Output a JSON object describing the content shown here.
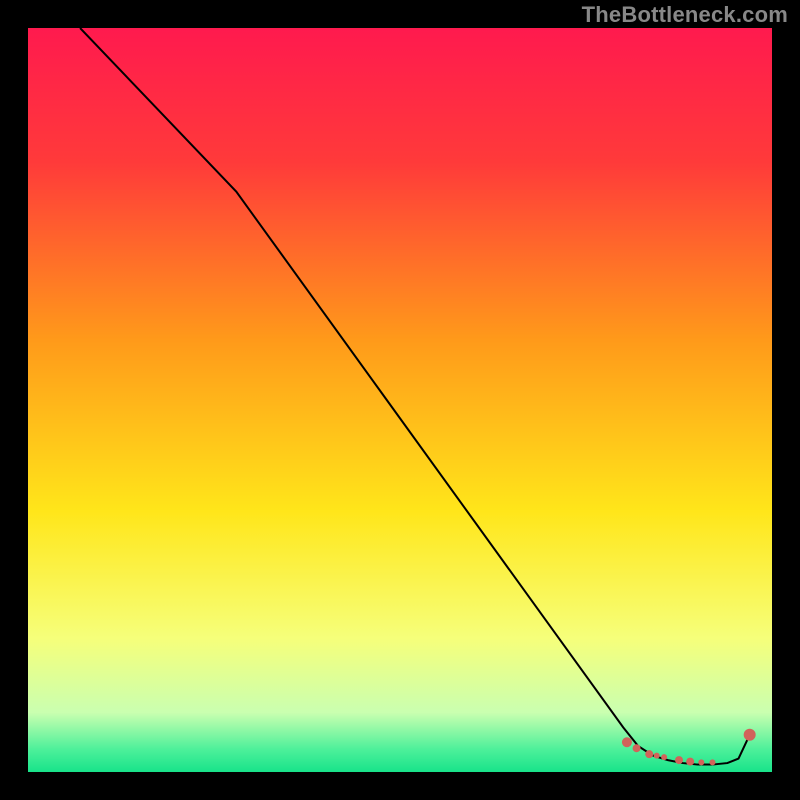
{
  "watermark": "TheBottleneck.com",
  "chart_data": {
    "type": "line",
    "title": "",
    "xlabel": "",
    "ylabel": "",
    "xlim": [
      0,
      100
    ],
    "ylim": [
      0,
      100
    ],
    "grid": false,
    "legend": null,
    "gradient": [
      {
        "pct": 0,
        "color": "#ff1a4e"
      },
      {
        "pct": 18,
        "color": "#ff3a3a"
      },
      {
        "pct": 42,
        "color": "#ff9a1a"
      },
      {
        "pct": 65,
        "color": "#ffe61a"
      },
      {
        "pct": 82,
        "color": "#f6ff7a"
      },
      {
        "pct": 92,
        "color": "#caffb0"
      },
      {
        "pct": 97,
        "color": "#4cf09a"
      },
      {
        "pct": 100,
        "color": "#18e38a"
      }
    ],
    "series": [
      {
        "name": "bottleneck_curve",
        "color": "#000000",
        "x": [
          7,
          28,
          80,
          82,
          84,
          86,
          88,
          90,
          92,
          94,
          95.5,
          97
        ],
        "y": [
          100,
          78,
          6,
          3.5,
          2.2,
          1.6,
          1.2,
          1.0,
          1.0,
          1.2,
          1.8,
          5
        ]
      },
      {
        "name": "highlight_markers",
        "type": "scatter",
        "color": "#d1635a",
        "radius": [
          5,
          4,
          4,
          3,
          3,
          4,
          4,
          3,
          3,
          6
        ],
        "x": [
          80.5,
          81.8,
          83.5,
          84.5,
          85.5,
          87.5,
          89.0,
          90.5,
          92.0,
          97.0
        ],
        "y": [
          4.0,
          3.2,
          2.4,
          2.2,
          2.0,
          1.6,
          1.4,
          1.3,
          1.3,
          5.0
        ]
      }
    ]
  }
}
